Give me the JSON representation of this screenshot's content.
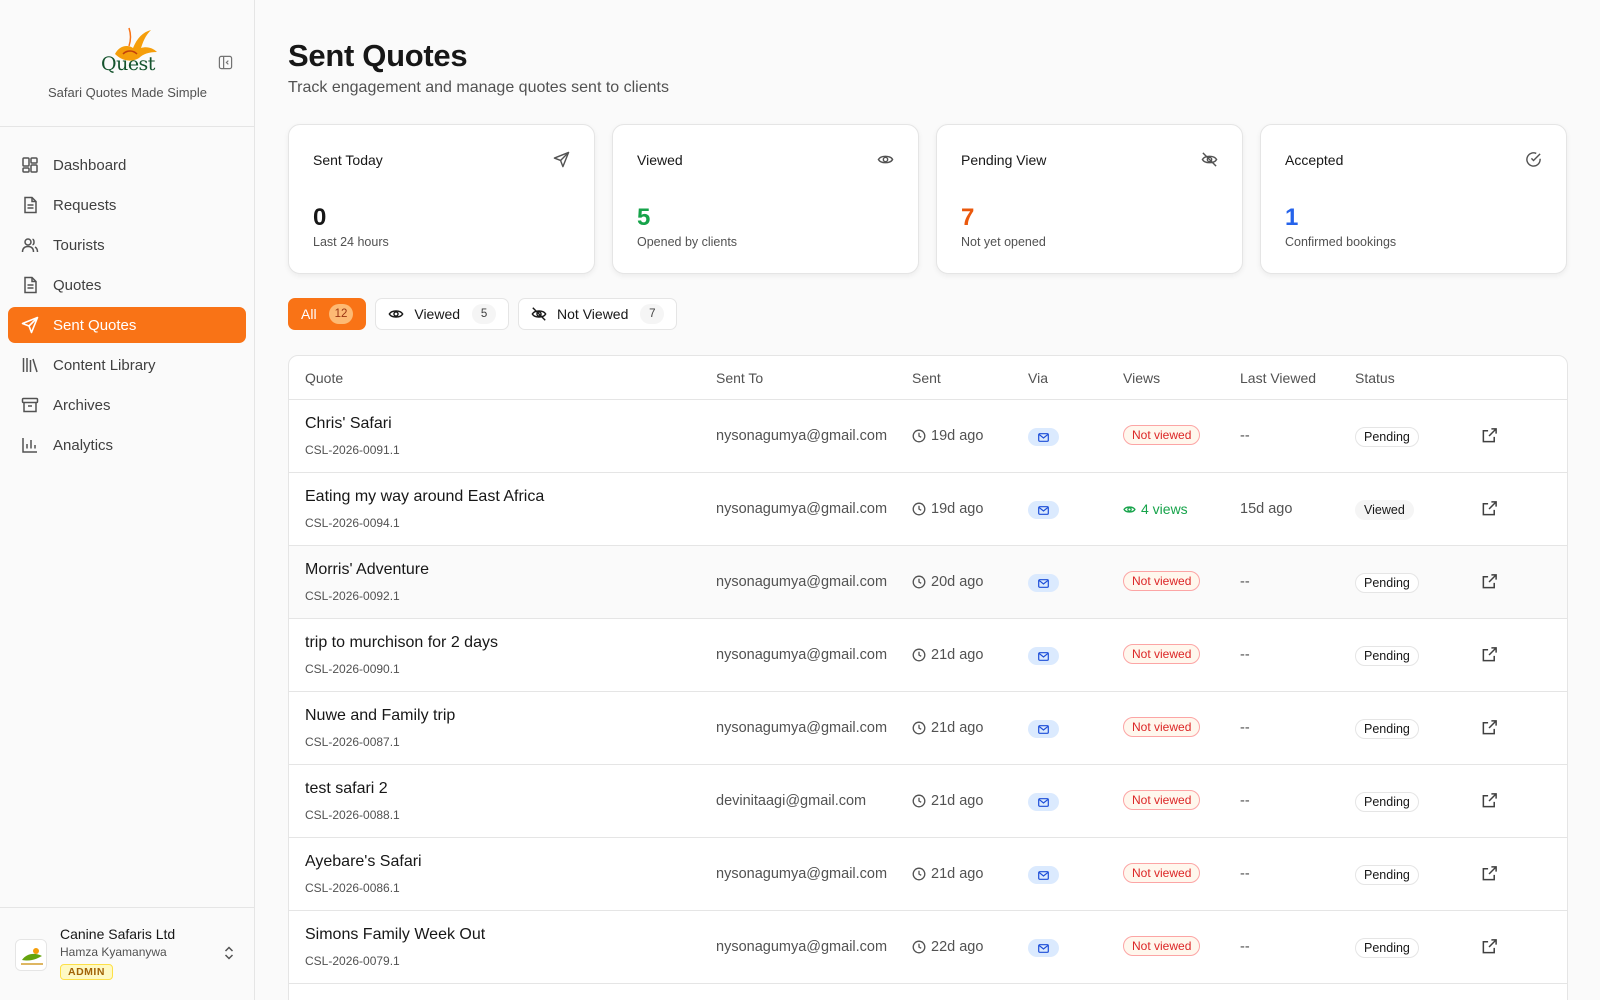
{
  "brand": {
    "logo_text": "Quest",
    "tagline": "Safari Quotes Made Simple"
  },
  "nav": {
    "items": [
      {
        "label": "Dashboard",
        "icon": "dashboard-icon"
      },
      {
        "label": "Requests",
        "icon": "file-text-icon"
      },
      {
        "label": "Tourists",
        "icon": "users-icon"
      },
      {
        "label": "Quotes",
        "icon": "file-text-icon"
      },
      {
        "label": "Sent Quotes",
        "icon": "send-icon",
        "active": true
      },
      {
        "label": "Content Library",
        "icon": "library-icon"
      },
      {
        "label": "Archives",
        "icon": "archive-icon"
      },
      {
        "label": "Analytics",
        "icon": "bar-chart-icon"
      }
    ]
  },
  "account": {
    "company": "Canine Safaris Ltd",
    "user": "Hamza Kyamanywa",
    "role": "ADMIN"
  },
  "page": {
    "title": "Sent Quotes",
    "subtitle": "Track engagement and manage quotes sent to clients"
  },
  "cards": [
    {
      "label": "Sent Today",
      "value": "0",
      "sub": "Last 24 hours",
      "color": "#171717",
      "icon": "send-icon"
    },
    {
      "label": "Viewed",
      "value": "5",
      "sub": "Opened by clients",
      "color": "#16a34a",
      "icon": "eye-icon"
    },
    {
      "label": "Pending View",
      "value": "7",
      "sub": "Not yet opened",
      "color": "#ea580c",
      "icon": "eye-off-icon"
    },
    {
      "label": "Accepted",
      "value": "1",
      "sub": "Confirmed bookings",
      "color": "#2563eb",
      "icon": "check-circle-icon"
    }
  ],
  "filters": [
    {
      "label": "All",
      "count": "12",
      "active": true
    },
    {
      "label": "Viewed",
      "count": "5",
      "icon": "eye-icon"
    },
    {
      "label": "Not Viewed",
      "count": "7",
      "icon": "eye-off-icon"
    }
  ],
  "table": {
    "headers": {
      "quote": "Quote",
      "sent_to": "Sent To",
      "sent": "Sent",
      "via": "Via",
      "views": "Views",
      "last_viewed": "Last Viewed",
      "status": "Status"
    },
    "rows": [
      {
        "title": "Chris' Safari",
        "code": "CSL-2026-0091.1",
        "email": "nysonagumya@gmail.com",
        "sent": "19d ago",
        "views": "Not viewed",
        "viewed": false,
        "last": "--",
        "status": "Pending"
      },
      {
        "title": "Eating my way around East Africa",
        "code": "CSL-2026-0094.1",
        "email": "nysonagumya@gmail.com",
        "sent": "19d ago",
        "views": "4 views",
        "viewed": true,
        "last": "15d ago",
        "status": "Viewed"
      },
      {
        "title": "Morris' Adventure",
        "code": "CSL-2026-0092.1",
        "email": "nysonagumya@gmail.com",
        "sent": "20d ago",
        "views": "Not viewed",
        "viewed": false,
        "last": "--",
        "status": "Pending"
      },
      {
        "title": "trip to murchison for 2 days",
        "code": "CSL-2026-0090.1",
        "email": "nysonagumya@gmail.com",
        "sent": "21d ago",
        "views": "Not viewed",
        "viewed": false,
        "last": "--",
        "status": "Pending"
      },
      {
        "title": "Nuwe and Family trip",
        "code": "CSL-2026-0087.1",
        "email": "nysonagumya@gmail.com",
        "sent": "21d ago",
        "views": "Not viewed",
        "viewed": false,
        "last": "--",
        "status": "Pending"
      },
      {
        "title": "test safari 2",
        "code": "CSL-2026-0088.1",
        "email": "devinitaagi@gmail.com",
        "sent": "21d ago",
        "views": "Not viewed",
        "viewed": false,
        "last": "--",
        "status": "Pending"
      },
      {
        "title": "Ayebare's Safari",
        "code": "CSL-2026-0086.1",
        "email": "nysonagumya@gmail.com",
        "sent": "21d ago",
        "views": "Not viewed",
        "viewed": false,
        "last": "--",
        "status": "Pending"
      },
      {
        "title": "Simons Family Week Out",
        "code": "CSL-2026-0079.1",
        "email": "nysonagumya@gmail.com",
        "sent": "22d ago",
        "views": "Not viewed",
        "viewed": false,
        "last": "--",
        "status": "Pending"
      }
    ]
  },
  "colors": {
    "accent": "#f97316",
    "viewed_green": "#16a34a",
    "pending_orange": "#ea580c",
    "accepted_blue": "#2563eb"
  }
}
